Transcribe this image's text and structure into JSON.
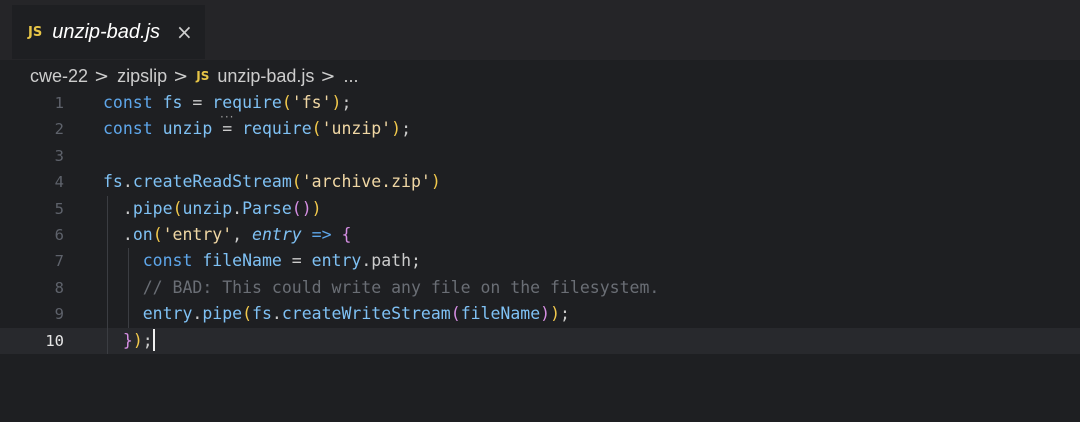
{
  "tab": {
    "badge": "JS",
    "title": "unzip-bad.js",
    "close_icon": "×"
  },
  "breadcrumb": {
    "items": [
      "cwe-22",
      "zipslip",
      "unzip-bad.js",
      "..."
    ],
    "separator": ">",
    "file_badge": "JS"
  },
  "editor": {
    "current_line": 10,
    "line_numbers": [
      "1",
      "2",
      "3",
      "4",
      "5",
      "6",
      "7",
      "8",
      "9",
      "10"
    ],
    "lines": [
      {
        "tokens": [
          [
            "kw",
            "const "
          ],
          [
            "var",
            "fs"
          ],
          [
            "op",
            " = "
          ],
          [
            "fn",
            "require"
          ],
          [
            "br1",
            "("
          ],
          [
            "str",
            "'fs'"
          ],
          [
            "br1",
            ")"
          ],
          [
            "op",
            ";"
          ]
        ]
      },
      {
        "tokens": [
          [
            "kw",
            "const "
          ],
          [
            "var",
            "unzip"
          ],
          [
            "op",
            " = "
          ],
          [
            "fn",
            "require"
          ],
          [
            "br1",
            "("
          ],
          [
            "str",
            "'unzip'"
          ],
          [
            "br1",
            ")"
          ],
          [
            "op",
            ";"
          ]
        ]
      },
      {
        "tokens": []
      },
      {
        "tokens": [
          [
            "var",
            "fs"
          ],
          [
            "op",
            "."
          ],
          [
            "fn",
            "createReadStream"
          ],
          [
            "br1",
            "("
          ],
          [
            "str",
            "'archive.zip'"
          ],
          [
            "br1",
            ")"
          ]
        ]
      },
      {
        "tokens": [
          [
            "op",
            "  ."
          ],
          [
            "fn",
            "pipe"
          ],
          [
            "br1",
            "("
          ],
          [
            "var",
            "unzip"
          ],
          [
            "op",
            "."
          ],
          [
            "fn",
            "Parse"
          ],
          [
            "br2",
            "()"
          ],
          [
            "br1",
            ")"
          ]
        ]
      },
      {
        "tokens": [
          [
            "op",
            "  ."
          ],
          [
            "fn",
            "on"
          ],
          [
            "br1",
            "("
          ],
          [
            "str",
            "'entry'"
          ],
          [
            "op",
            ", "
          ],
          [
            "param",
            "entry"
          ],
          [
            "arrow",
            " => "
          ],
          [
            "br2",
            "{"
          ]
        ]
      },
      {
        "tokens": [
          [
            "op",
            "    "
          ],
          [
            "kw",
            "const "
          ],
          [
            "var",
            "fileName"
          ],
          [
            "op",
            " = "
          ],
          [
            "var",
            "entry"
          ],
          [
            "op",
            ".path;"
          ]
        ]
      },
      {
        "tokens": [
          [
            "op",
            "    "
          ],
          [
            "com",
            "// BAD: This could write any file on the filesystem."
          ]
        ]
      },
      {
        "tokens": [
          [
            "op",
            "    "
          ],
          [
            "var",
            "entry"
          ],
          [
            "op",
            "."
          ],
          [
            "fn",
            "pipe"
          ],
          [
            "br1",
            "("
          ],
          [
            "var",
            "fs"
          ],
          [
            "op",
            "."
          ],
          [
            "fn",
            "createWriteStream"
          ],
          [
            "br2",
            "("
          ],
          [
            "var",
            "fileName"
          ],
          [
            "br2",
            ")"
          ],
          [
            "br1",
            ")"
          ],
          [
            "op",
            ";"
          ]
        ]
      },
      {
        "tokens": [
          [
            "op",
            "  "
          ],
          [
            "br2",
            "}"
          ],
          [
            "br1",
            ")"
          ],
          [
            "op",
            ";"
          ]
        ]
      }
    ]
  },
  "colors": {
    "background": "#1e1f22",
    "tabbar": "#252528",
    "js_badge": "#e7c547",
    "keyword": "#5ea6ea",
    "string": "#f0d7a4",
    "comment": "#6a6e75"
  }
}
